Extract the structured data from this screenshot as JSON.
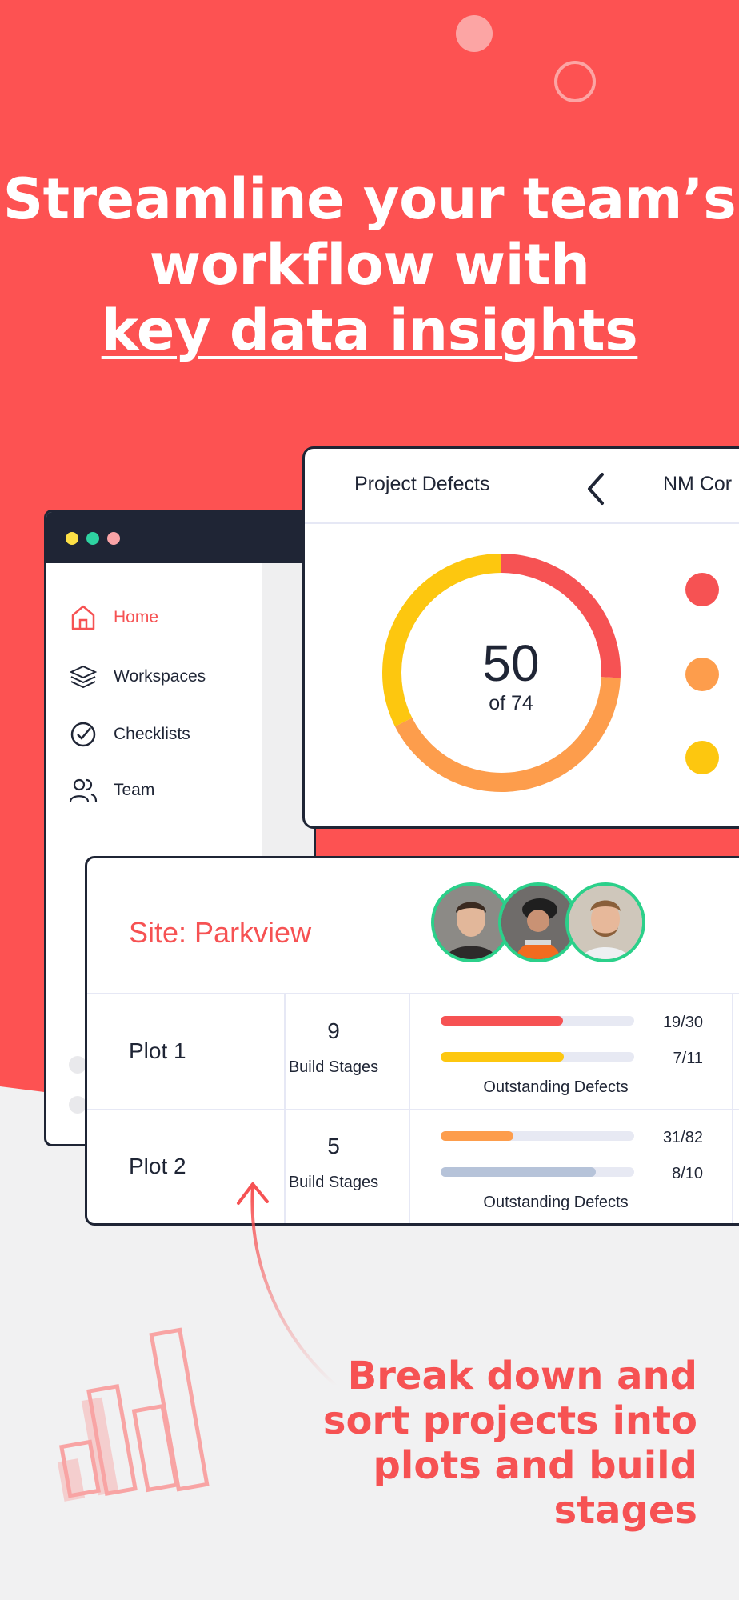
{
  "hero": {
    "headline_line1": "Streamline your team’s",
    "headline_line2": "workflow with",
    "headline_line3": "key data insights"
  },
  "colors": {
    "brand_red": "#f65253",
    "navy": "#1f2535",
    "orange": "#fd9d4c",
    "yellow": "#fdc70f",
    "green": "#2bd08a",
    "slate": "#b6c3d9"
  },
  "sidebar": {
    "items": [
      {
        "label": "Home",
        "icon": "home-icon",
        "active": true
      },
      {
        "label": "Workspaces",
        "icon": "layers-icon",
        "active": false
      },
      {
        "label": "Checklists",
        "icon": "check-circle-icon",
        "active": false
      },
      {
        "label": "Team",
        "icon": "users-icon",
        "active": false
      }
    ]
  },
  "defects": {
    "title": "Project Defects",
    "next_tab": "NM Cor",
    "count": "50",
    "of_total": "of 74",
    "segments": [
      {
        "color": "#f65253",
        "value": 19
      },
      {
        "color": "#fd9d4c",
        "value": 31
      },
      {
        "color": "#fdc70f",
        "value": 24
      }
    ]
  },
  "site": {
    "title": "Site: Parkview",
    "team_avatars": [
      "avatar-man-1",
      "avatar-worker-2",
      "avatar-man-3"
    ],
    "plots": [
      {
        "name": "Plot 1",
        "stages": "9",
        "stages_label": "Build Stages",
        "bars": [
          {
            "value": "19/30",
            "fraction": 0.633,
            "color": "#f65253"
          },
          {
            "value": "7/11",
            "fraction": 0.636,
            "color": "#fdc70f"
          }
        ],
        "defects_label": "Outstanding Defects"
      },
      {
        "name": "Plot 2",
        "stages": "5",
        "stages_label": "Build Stages",
        "bars": [
          {
            "value": "31/82",
            "fraction": 0.378,
            "color": "#fd9d4c"
          },
          {
            "value": "8/10",
            "fraction": 0.8,
            "color": "#b6c3d9"
          }
        ],
        "defects_label": "Outstanding Defects"
      }
    ]
  },
  "caption": {
    "line1": "Break down and",
    "line2": "sort projects into",
    "line3": "plots and build",
    "line4": "stages"
  }
}
